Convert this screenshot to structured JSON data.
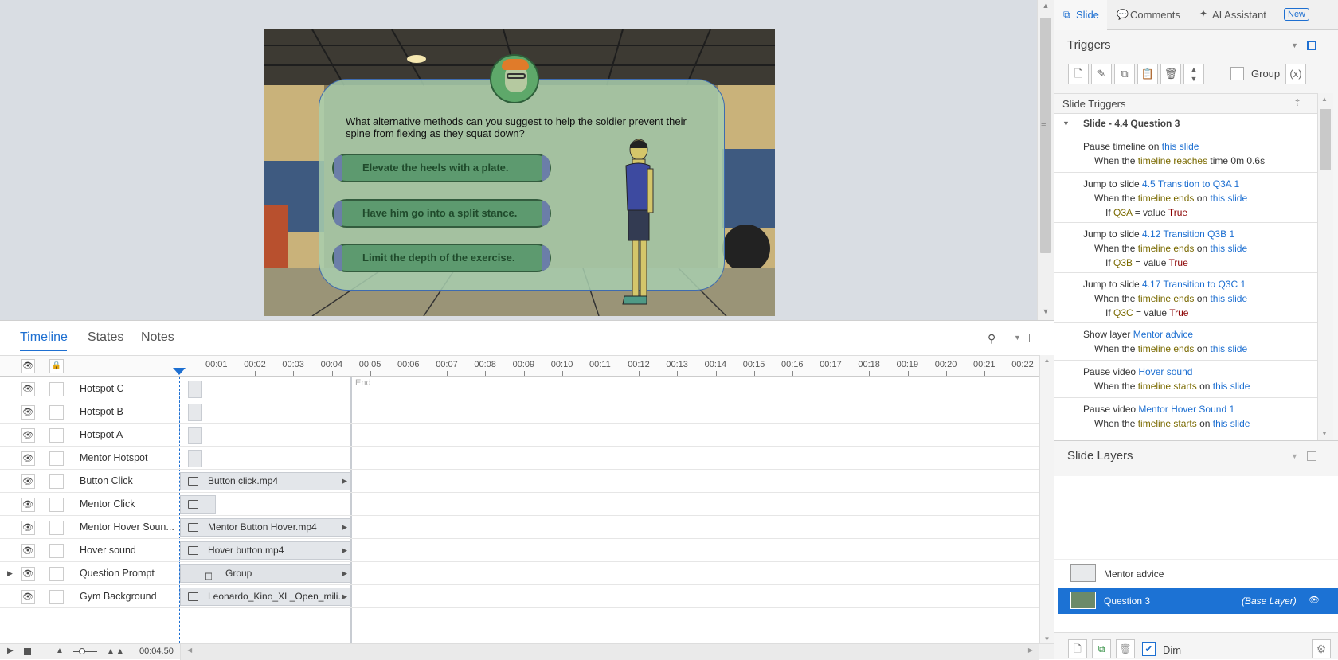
{
  "slide": {
    "question": "What alternative methods can you suggest to help the soldier prevent their spine from flexing as they squat down?",
    "answers": [
      "Elevate the heels with a plate.",
      "Have him go into a split stance.",
      "Limit the depth of the exercise."
    ]
  },
  "timeline_panel": {
    "tabs": [
      "Timeline",
      "States",
      "Notes"
    ],
    "ruler": [
      "00:01",
      "00:02",
      "00:03",
      "00:04",
      "00:05",
      "00:06",
      "00:07",
      "00:08",
      "00:09",
      "00:10",
      "00:11",
      "00:12",
      "00:13",
      "00:14",
      "00:15",
      "00:16",
      "00:17",
      "00:18",
      "00:19",
      "00:20",
      "00:21",
      "00:22"
    ],
    "end_label": "End",
    "time_display": "00:04.50",
    "rows": [
      {
        "name": "Hotspot C",
        "bar": ""
      },
      {
        "name": "Hotspot B",
        "bar": ""
      },
      {
        "name": "Hotspot A",
        "bar": ""
      },
      {
        "name": "Mentor Hotspot",
        "bar": ""
      },
      {
        "name": "Button Click",
        "bar": "Button click.mp4"
      },
      {
        "name": "Mentor Click",
        "bar": ""
      },
      {
        "name": "Mentor Hover Soun...",
        "bar": "Mentor Button Hover.mp4"
      },
      {
        "name": "Hover sound",
        "bar": "Hover button.mp4"
      },
      {
        "name": "Question Prompt",
        "bar": "Group"
      },
      {
        "name": "Gym Background",
        "bar": "Leonardo_Kino_XL_Open_mili..."
      }
    ]
  },
  "right_panel": {
    "tabs": {
      "slide": "Slide",
      "comments": "Comments",
      "ai": "AI Assistant",
      "new_badge": "New"
    },
    "triggers_title": "Triggers",
    "group_label": "Group",
    "slide_triggers_title": "Slide Triggers",
    "slide_group": "Slide - 4.4 Question 3",
    "triggers": [
      {
        "l1_pre": "Pause timeline on ",
        "l1_link": "this slide",
        "l2_pre": "When the ",
        "l2_kw": "timeline reaches",
        "l2_mid": " time ",
        "l2_val": "0m 0.6s"
      },
      {
        "l1_pre": "Jump to slide ",
        "l1_link": "4.5 Transition to Q3A 1",
        "l2_pre": "When the ",
        "l2_kw": "timeline ends",
        "l2_mid": " on ",
        "l2_link": "this slide",
        "l3_pre": "If ",
        "l3_var": "Q3A",
        "l3_mid": " = value ",
        "l3_val": "True"
      },
      {
        "l1_pre": "Jump to slide ",
        "l1_link": "4.12 Transition Q3B 1",
        "l2_pre": "When the ",
        "l2_kw": "timeline ends",
        "l2_mid": " on ",
        "l2_link": "this slide",
        "l3_pre": "If ",
        "l3_var": "Q3B",
        "l3_mid": " = value ",
        "l3_val": "True"
      },
      {
        "l1_pre": "Jump to slide ",
        "l1_link": "4.17 Transition to Q3C 1",
        "l2_pre": "When the ",
        "l2_kw": "timeline ends",
        "l2_mid": " on ",
        "l2_link": "this slide",
        "l3_pre": "If ",
        "l3_var": "Q3C",
        "l3_mid": " = value ",
        "l3_val": "True"
      },
      {
        "l1_pre": "Show layer ",
        "l1_link": "Mentor advice",
        "l2_pre": "When the ",
        "l2_kw": "timeline ends",
        "l2_mid": " on ",
        "l2_link": "this slide"
      },
      {
        "l1_pre": "Pause video ",
        "l1_link": "Hover sound",
        "l2_pre": "When the ",
        "l2_kw": "timeline starts",
        "l2_mid": " on ",
        "l2_link": "this slide"
      },
      {
        "l1_pre": "Pause video ",
        "l1_link": "Mentor Hover Sound 1",
        "l2_pre": "When the ",
        "l2_kw": "timeline starts",
        "l2_mid": " on ",
        "l2_link": "this slide"
      }
    ],
    "layers_title": "Slide Layers",
    "layers": [
      {
        "name": "Mentor advice"
      },
      {
        "name": "Question 3",
        "tag": "(Base Layer)"
      }
    ],
    "dim_label": "Dim"
  },
  "colors": {
    "accent": "#1d6fd1",
    "selected_layer": "#1c72d4"
  }
}
